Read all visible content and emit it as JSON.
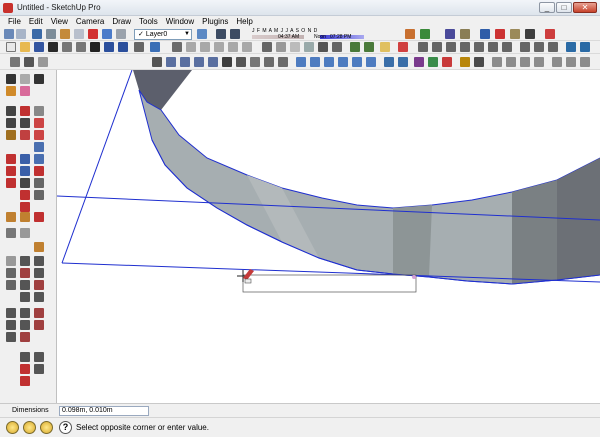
{
  "window": {
    "title": "Untitled - SketchUp Pro",
    "minimize": "_",
    "maximize": "□",
    "close": "✕"
  },
  "menubar": [
    "File",
    "Edit",
    "View",
    "Camera",
    "Draw",
    "Tools",
    "Window",
    "Plugins",
    "Help"
  ],
  "layers": {
    "current": "Layer0",
    "checkmark": "✓",
    "dropdown_arrow": "▼"
  },
  "shadows": {
    "months": "J F M A M J J A S O N D",
    "time_start": "04:37 AM",
    "noon": "Noon",
    "time_end": "07:28 PM"
  },
  "dimensions": {
    "label": "Dimensions",
    "value": "0.098m, 0.010m"
  },
  "status": {
    "message": "Select opposite corner or enter value."
  },
  "colors": {
    "edge_blue": "#1f2fcf",
    "face_grey": "#9ea7ab",
    "face_dark": "#5c5f6c",
    "status_icon": "#e8b93a"
  },
  "icons": {
    "toolbar_row1": [
      "new-icon",
      "open-icon",
      "save-icon",
      "cut-icon",
      "copy-icon",
      "paste-icon",
      "erase-icon",
      "undo-icon",
      "redo-icon",
      "print-icon",
      "model-info-icon"
    ],
    "left_tools": [
      "select-icon",
      "component-icon",
      "paint-bucket-icon",
      "eraser-icon",
      "rectangle-icon",
      "line-icon",
      "circle-icon",
      "arc-icon",
      "polygon-icon",
      "freehand-icon",
      "move-icon",
      "push-pull-icon",
      "rotate-icon",
      "follow-me-icon",
      "scale-icon",
      "offset-icon",
      "tape-measure-icon",
      "dimension-icon",
      "protractor-icon",
      "text-icon",
      "axes-icon",
      "3d-text-icon",
      "orbit-icon",
      "pan-icon",
      "zoom-icon",
      "zoom-window-icon",
      "zoom-extents-icon",
      "walk-icon",
      "look-around-icon",
      "position-camera-icon",
      "section-plane-icon"
    ]
  }
}
